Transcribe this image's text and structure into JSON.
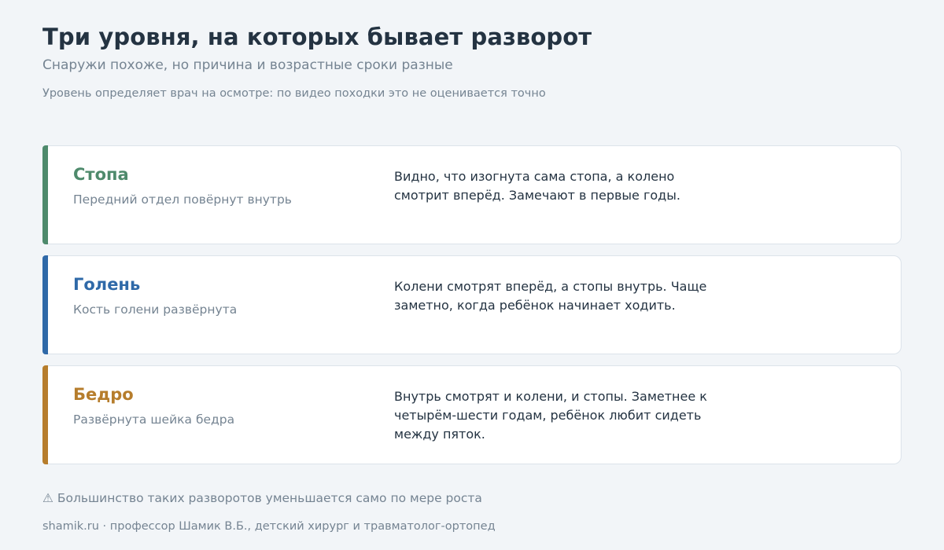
{
  "header": {
    "title": "Три уровня, на которых бывает разворот",
    "subtitle": "Снаружи похоже, но причина и возрастные сроки разные",
    "note": "Уровень определяет врач на осмотре: по видео походки это не оценивается точно"
  },
  "cards": [
    {
      "name": "Стопа",
      "caption": "Передний отдел повёрнут внутрь",
      "description": "Видно, что изогнута сама стопа, а колено смотрит вперёд. Замечают в первые годы.",
      "color": "#4e8a6c"
    },
    {
      "name": "Голень",
      "caption": "Кость голени развёрнута",
      "description": "Колени смотрят вперёд, а стопы внутрь. Чаще заметно, когда ребёнок начинает ходить.",
      "color": "#2f69a8"
    },
    {
      "name": "Бедро",
      "caption": "Развёрнута шейка бедра",
      "description": "Внутрь смотрят и колени, и стопы. Заметнее к четырём-шести годам, ребёнок любит сидеть между пяток.",
      "color": "#b67d2c"
    }
  ],
  "warning": {
    "icon": "⚠",
    "text": "Большинство таких разворотов уменьшается само по мере роста"
  },
  "footer": {
    "text": "shamik.ru · профессор Шамик В.Б., детский хирург и травматолог-ортопед"
  }
}
